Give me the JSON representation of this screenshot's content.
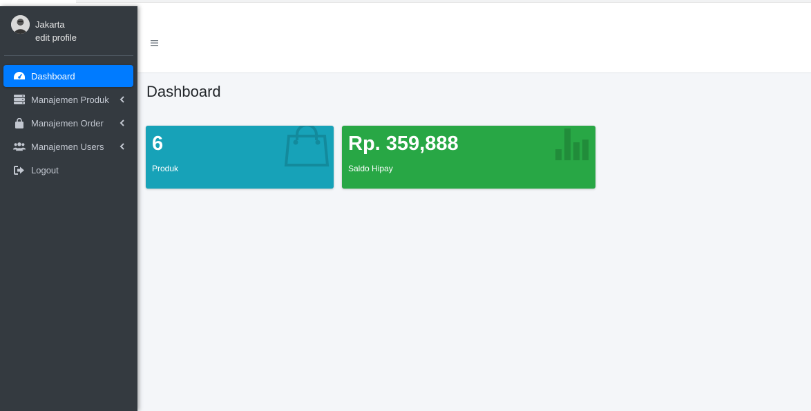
{
  "user": {
    "name": "Jakarta",
    "edit_profile": "edit profile"
  },
  "sidebar": {
    "items": [
      {
        "label": "Dashboard",
        "icon": "tachometer-icon",
        "active": true,
        "has_submenu": false
      },
      {
        "label": "Manajemen Produk",
        "icon": "server-icon",
        "active": false,
        "has_submenu": true
      },
      {
        "label": "Manajemen Order",
        "icon": "shopping-bag-icon",
        "active": false,
        "has_submenu": true
      },
      {
        "label": "Manajemen Users",
        "icon": "users-icon",
        "active": false,
        "has_submenu": true
      },
      {
        "label": "Logout",
        "icon": "sign-out-icon",
        "active": false,
        "has_submenu": false
      }
    ]
  },
  "header": {
    "menu_icon": "hamburger-icon"
  },
  "page": {
    "title": "Dashboard"
  },
  "cards": [
    {
      "value": "6",
      "label": "Produk",
      "icon": "shopping-bag-icon",
      "color": "#17a2b8"
    },
    {
      "value": "Rp. 359,888",
      "label": "Saldo Hipay",
      "icon": "bar-chart-icon",
      "color": "#28a745"
    }
  ],
  "colors": {
    "sidebar_bg": "#343a40",
    "active_item": "#007bff",
    "content_bg": "#f4f6f9"
  }
}
